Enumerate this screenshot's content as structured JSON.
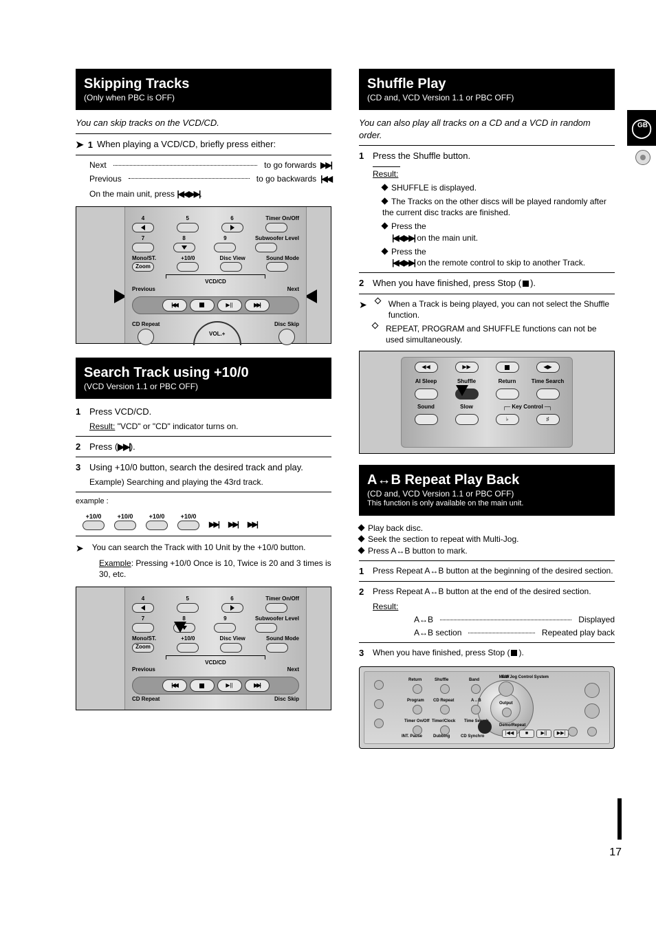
{
  "side": {
    "letter": "GB"
  },
  "page_number": "17",
  "left": {
    "bar1": {
      "title": "Skipping Tracks",
      "sub": "(Only when PBC is OFF)"
    },
    "intro1": "You can skip tracks on the VCD/CD.",
    "step1_num": "1",
    "step1_text": "When playing a VCD/CD, briefly press either:",
    "skip_next_label": "Next",
    "skip_next_desc": "to go forwards",
    "skip_next_icon": "▶▶|",
    "skip_prev_label": "Previous",
    "skip_prev_desc": "to go backwards",
    "skip_prev_icon": "|◀◀",
    "skip_unit": "On the main unit, press",
    "skip_unit_icons": "|◀◀  ▶▶|",
    "bar2": {
      "title": "Search Track using +10/0",
      "sub": "(VCD Version 1.1 or PBC OFF)"
    },
    "s2_step1_num": "1",
    "s2_step1_text": "Press VCD/CD.",
    "s2_result_label": "Result:",
    "s2_result_text": "\"VCD\" or \"CD\" indicator turns on.",
    "s2_step2_num": "2",
    "s2_step2_text_a": "Press (",
    "s2_step2_icon": "▶▶|",
    "s2_step2_text_b": ").",
    "s2_step3_num": "3",
    "s2_step3_text": "Using +10/0 button, search the desired track and play.",
    "s2_example_lead": "Example) Searching and playing the 43rd track.",
    "s2_example_label": "example :",
    "plus10": "+10/0",
    "next_ico": "▶▶|",
    "note_label": "You can search the Track with 10 Unit by the +10/0 button.",
    "note_example": "Example: Pressing +10/0 Once is 10, Twice is 20 and 3 times is 30, etc.",
    "remote": {
      "r1": [
        "4",
        "5",
        "6"
      ],
      "timer": "Timer On/Off",
      "r2": [
        "7",
        "8",
        "9"
      ],
      "sub": "Subwoofer Level",
      "r3": [
        "Mono/ST.",
        "+10/0",
        "Disc View",
        "Sound Mode"
      ],
      "zoom": "Zoom",
      "vcdcd": "VCD/CD",
      "prev": "Previous",
      "next": "Next",
      "cdrepeat": "CD Repeat",
      "discskip": "Disc Skip",
      "vol": "VOL.+"
    }
  },
  "right": {
    "bar1": {
      "title": "Shuffle Play",
      "sub": "(CD and, VCD Version 1.1 or PBC OFF)"
    },
    "r_intro": "You can also play all tracks on a CD and a VCD in random order.",
    "r_step1_num": "1",
    "r_step1_text": "Press the Shuffle button.",
    "r_result_label": "Result:",
    "r_bullet1": "SHUFFLE is displayed.",
    "r_bullet2": "The Tracks on the other discs will be played randomly after the current disc tracks are finished.",
    "r_bullet3_a": "Press the",
    "r_bullet3_icons": "|◀◀  ▶▶|",
    "r_bullet3_b": "on the main unit.",
    "r_bullet4_a": "Press the",
    "r_bullet4_icons": "|◀◀  ▶▶|",
    "r_bullet4_b": "on the remote control to skip to another Track.",
    "r_step2_num": "2",
    "r_step2_text_a": "When you have finished, press Stop (",
    "r_step2_text_b": ").",
    "r_note1": "When a Track is being played, you can not select the Shuffle function.",
    "r_note2": "REPEAT, PROGRAM and SHUFFLE functions can not be used simultaneously.",
    "shuffle_labels": {
      "row0": [
        "◀◀",
        "▶▶",
        "■",
        "◀ ▶"
      ],
      "row1": [
        "AI Sleep",
        "Shuffle",
        "Return",
        "Time Search"
      ],
      "row2": [
        "Sound",
        "Slow",
        "Key Control -",
        "-Key Control"
      ],
      "key_b": "♭",
      "key_s": "♯"
    },
    "bar2": {
      "title": "A↔B Repeat Play Back",
      "sub": "(CD and, VCD Version 1.1 or PBC OFF)",
      "sub2": "This function is only available on the main unit."
    },
    "ab_b1": "Play back disc.",
    "ab_b2": "Seek the section to repeat with Multi-Jog.",
    "ab_b3": "Press A↔B button to mark.",
    "ab_step1_num": "1",
    "ab_step1_text": "Press Repeat A↔B button at the beginning of the desired section.",
    "ab_step2_num": "2",
    "ab_step2_text": "Press Repeat A↔B button at the end of the desired section.",
    "ab_result_label": "Result:",
    "ab_row1_l": "A↔B",
    "ab_row1_r": "Displayed",
    "ab_row2_l": "A↔B section",
    "ab_row2_r": "Repeated play back",
    "ab_step3_num": "3",
    "ab_step3_text_a": "When you have finished, press Stop (",
    "ab_step3_text_b": ").",
    "fp": {
      "jog_label": "Multi Jog Control System",
      "labels": [
        "Return",
        "Shuffle",
        "Band",
        "P.W",
        "Program",
        "CD Repeat",
        "A↔B",
        "Timer On/Off",
        "Timer/Clock",
        "Time Search",
        "INT. Pause",
        "Dubbing",
        "CD Synchro",
        "Demo/Repeat"
      ],
      "transport": [
        "|◀◀",
        "■",
        "▶||",
        "▶▶|"
      ],
      "Output": "Output"
    }
  }
}
